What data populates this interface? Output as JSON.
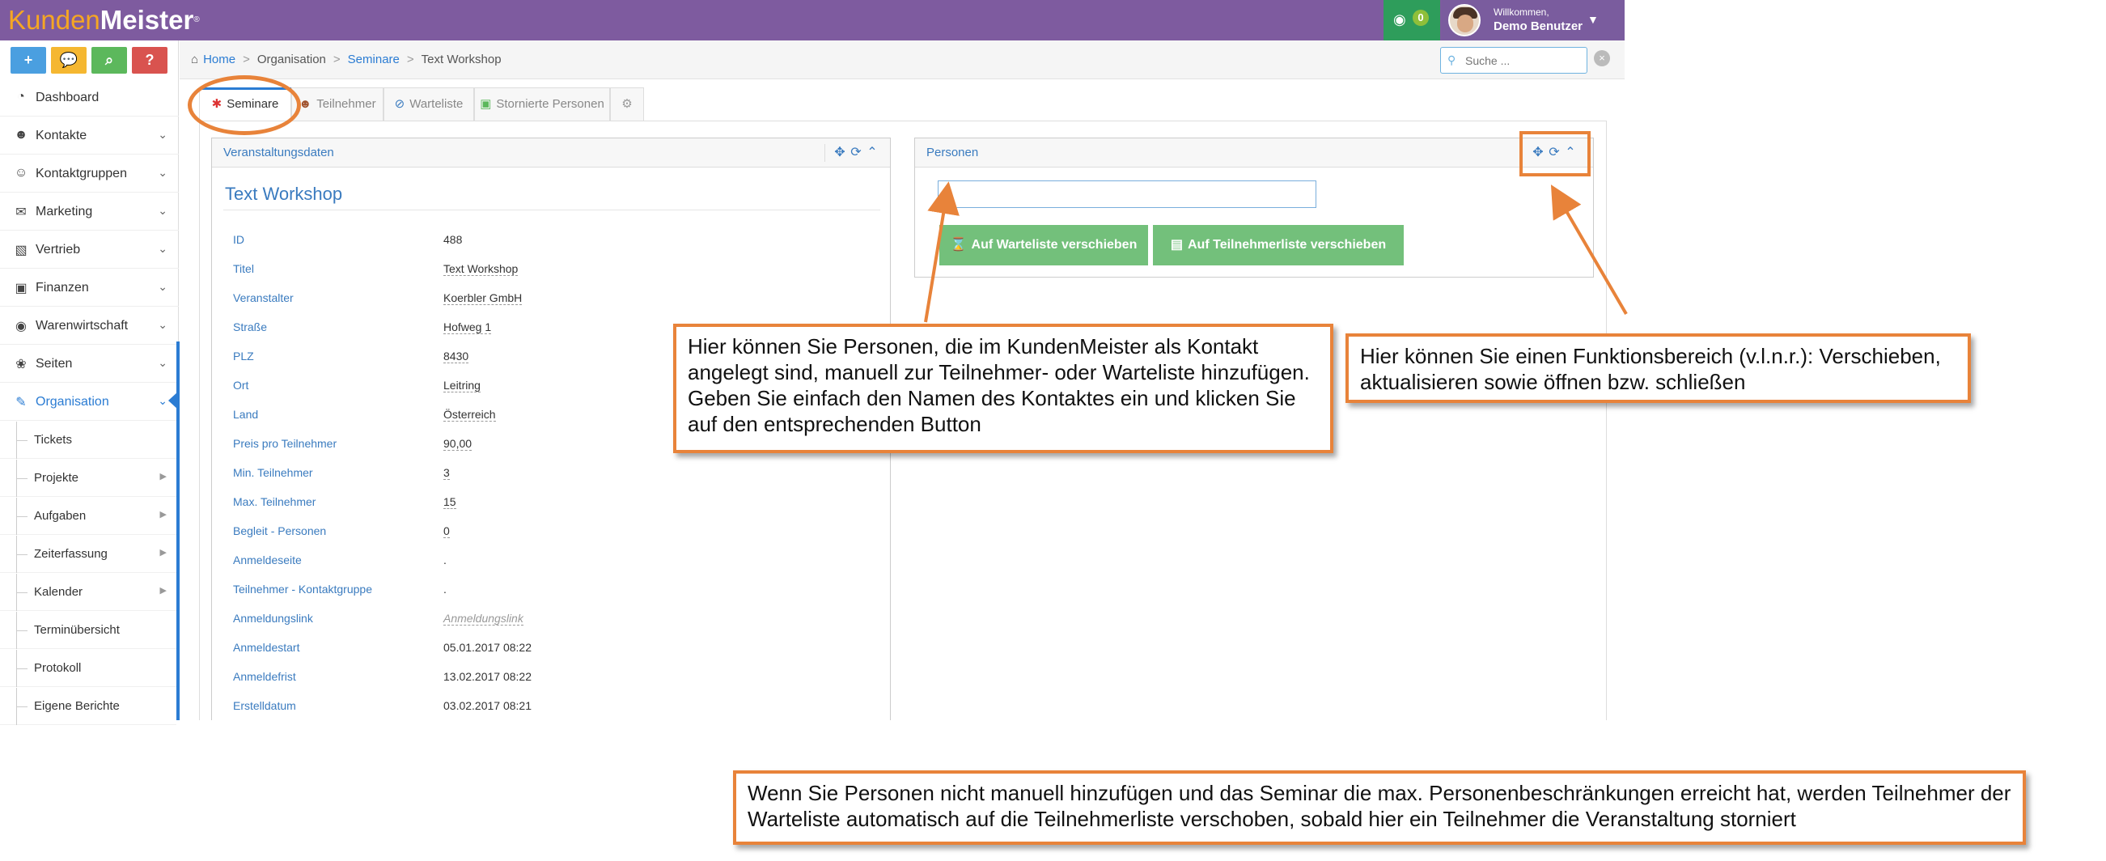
{
  "brand": {
    "part1": "Kunden",
    "part2": "Meister",
    "reg": "®"
  },
  "header": {
    "messages_count": "0",
    "welcome": "Willkommen,",
    "user_name": "Demo Benutzer"
  },
  "sidebar": {
    "quick_actions": [
      {
        "label": "+",
        "color": "#4a9fe0"
      },
      {
        "label": "💬",
        "color": "#f5b731"
      },
      {
        "label": "⌕",
        "color": "#5cb85c"
      },
      {
        "label": "?",
        "color": "#d9534f"
      }
    ],
    "items": [
      {
        "label": "Dashboard"
      },
      {
        "label": "Kontakte"
      },
      {
        "label": "Kontaktgruppen"
      },
      {
        "label": "Marketing"
      },
      {
        "label": "Vertrieb"
      },
      {
        "label": "Finanzen"
      },
      {
        "label": "Warenwirtschaft"
      },
      {
        "label": "Seiten"
      },
      {
        "label": "Organisation"
      }
    ],
    "subitems": [
      {
        "label": "Tickets"
      },
      {
        "label": "Projekte"
      },
      {
        "label": "Aufgaben"
      },
      {
        "label": "Zeiterfassung"
      },
      {
        "label": "Kalender"
      },
      {
        "label": "Terminübersicht"
      },
      {
        "label": "Protokoll"
      },
      {
        "label": "Eigene Berichte"
      }
    ]
  },
  "breadcrumb": {
    "home": "Home",
    "org": "Organisation",
    "seminare": "Seminare",
    "current": "Text Workshop"
  },
  "search": {
    "placeholder": "Suche ..."
  },
  "tabs": [
    {
      "label": "Seminare"
    },
    {
      "label": "Teilnehmer"
    },
    {
      "label": "Warteliste"
    },
    {
      "label": "Stornierte Personen"
    }
  ],
  "event_widget": {
    "title": "Veranstaltungsdaten",
    "heading": "Text Workshop",
    "rows": [
      {
        "key": "ID",
        "value": "488"
      },
      {
        "key": "Titel",
        "value": "Text Workshop"
      },
      {
        "key": "Veranstalter",
        "value": "Koerbler GmbH"
      },
      {
        "key": "Straße",
        "value": "Hofweg 1"
      },
      {
        "key": "PLZ",
        "value": "8430"
      },
      {
        "key": "Ort",
        "value": "Leitring"
      },
      {
        "key": "Land",
        "value": "Österreich"
      },
      {
        "key": "Preis pro Teilnehmer",
        "value": "90,00"
      },
      {
        "key": "Min. Teilnehmer",
        "value": "3"
      },
      {
        "key": "Max. Teilnehmer",
        "value": "15"
      },
      {
        "key": "Begleit - Personen",
        "value": "0"
      },
      {
        "key": "Anmeldeseite",
        "value": "."
      },
      {
        "key": "Teilnehmer - Kontaktgruppe",
        "value": "."
      },
      {
        "key": "Anmeldungslink",
        "value": "Anmeldungslink"
      },
      {
        "key": "Anmeldestart",
        "value": "05.01.2017 08:22"
      },
      {
        "key": "Anmeldefrist",
        "value": "13.02.2017 08:22"
      },
      {
        "key": "Erstelldatum",
        "value": "03.02.2017 08:21"
      }
    ]
  },
  "persons_widget": {
    "title": "Personen",
    "btn_waitlist": "Auf Warteliste verschieben",
    "btn_participants": "Auf Teilnehmerliste verschieben"
  },
  "annotations": {
    "callout_manual": "Hier können Sie Personen, die im KundenMeister als Kontakt angelegt sind, manuell zur Teilnehmer- oder Warteliste hinzufügen. Geben Sie einfach den Namen des Kontaktes ein und klicken Sie auf den entsprechenden Button",
    "callout_functions": "Hier können Sie einen Funktionsbereich (v.l.n.r.): Verschieben, aktualisieren sowie öffnen bzw. schließen",
    "callout_waitlist": "Wenn Sie Personen nicht manuell hinzufügen und das Seminar die max. Personenbeschränkungen erreicht hat, werden Teilnehmer der Warteliste automatisch auf die Teilnehmerliste verschoben, sobald hier ein Teilnehmer die Veranstaltung storniert",
    "color": "#e8833a"
  }
}
